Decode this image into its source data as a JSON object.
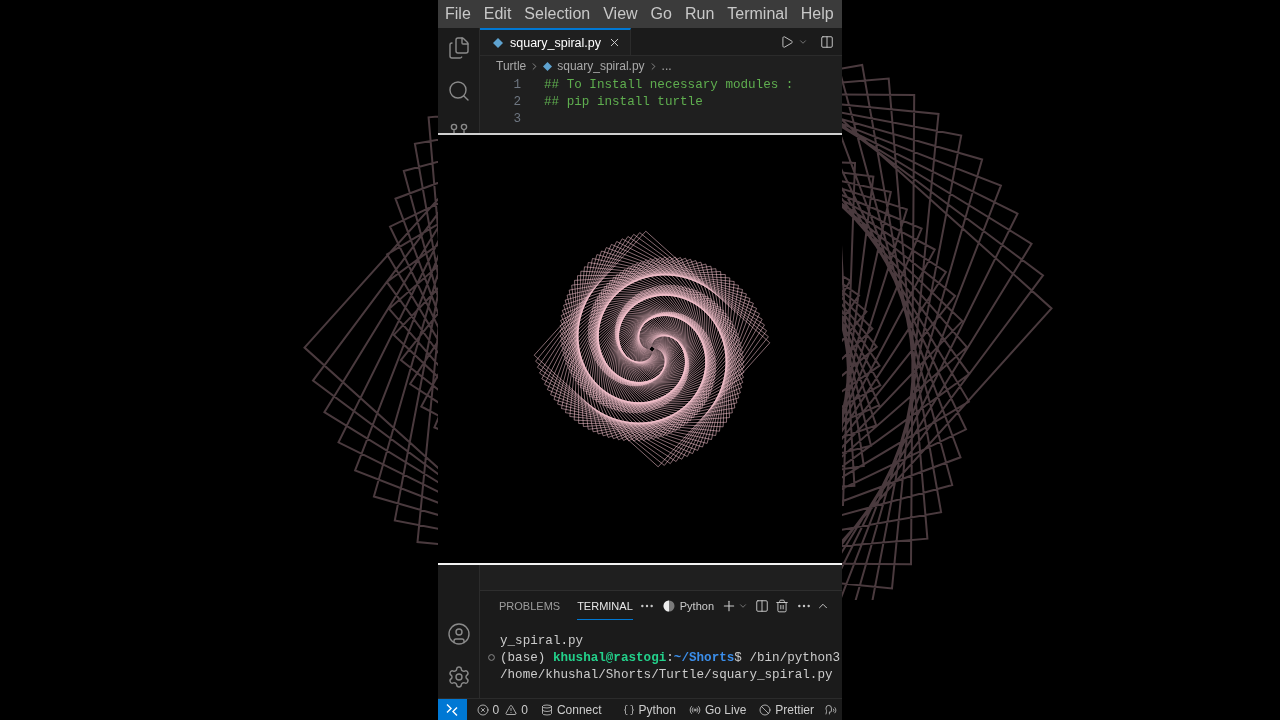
{
  "menu_bar": {
    "items": [
      "File",
      "Edit",
      "Selection",
      "View",
      "Go",
      "Run",
      "Terminal",
      "Help"
    ]
  },
  "editor": {
    "tabs": [
      {
        "label": "squary_spiral.py",
        "selected": true
      }
    ],
    "breadcrumb": [
      {
        "kind": "folder",
        "label": "Turtle"
      },
      {
        "kind": "file",
        "label": "squary_spiral.py"
      },
      {
        "kind": "symbols",
        "label": "..."
      }
    ],
    "lines": [
      {
        "number": "1",
        "text": "## To Install necessary modules :"
      },
      {
        "number": "2",
        "text": "## pip install turtle"
      },
      {
        "number": "3"
      }
    ]
  },
  "panel": {
    "tabs": [
      {
        "label": "PROBLEMS",
        "selected": false
      },
      {
        "label": "TERMINAL",
        "selected": true
      }
    ],
    "terminal_profile": "Python",
    "terminal_lines": [
      {
        "decorated": false,
        "segments": [
          {
            "kind": "output",
            "text": "y_spiral.py"
          }
        ]
      },
      {
        "decorated": true,
        "segments": [
          {
            "kind": "output",
            "text": "(base) "
          },
          {
            "kind": "user",
            "text": "khushal@rastogi"
          },
          {
            "kind": "output",
            "text": ":"
          },
          {
            "kind": "path",
            "text": "~/Shorts"
          },
          {
            "kind": "output",
            "text": "$ /bin/python3"
          }
        ]
      },
      {
        "decorated": false,
        "segments": [
          {
            "kind": "output",
            "text": "/home/khushal/Shorts/Turtle/squary_spiral.py"
          }
        ]
      }
    ]
  },
  "status_bar": {
    "errors": "0",
    "warnings": "0",
    "items": [
      {
        "kind": "database",
        "label": "Connect"
      },
      {
        "kind": "language",
        "label": "Python"
      },
      {
        "kind": "live",
        "label": "Go Live"
      },
      {
        "kind": "formatter",
        "label": "Prettier"
      }
    ]
  }
}
